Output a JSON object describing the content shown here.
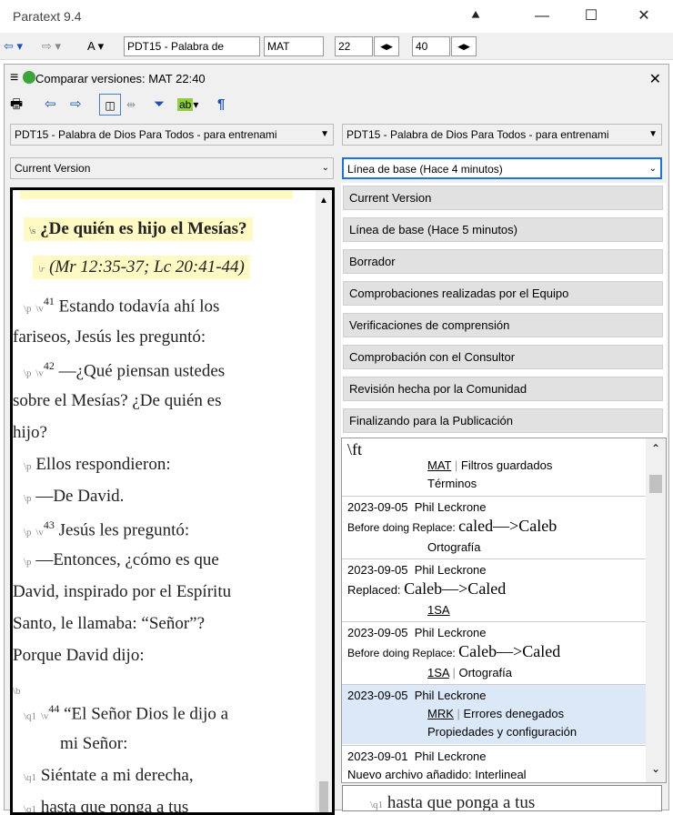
{
  "app": {
    "title": "Paratext 9.4"
  },
  "toolbar": {
    "back": "⇦ ▾",
    "forward": "⇨ ▾",
    "font": "A ▾",
    "project": "PDT15 - Palabra de",
    "book": "MAT",
    "chapter": "22",
    "verse": "40"
  },
  "panel": {
    "title": "Comparar versiones: MAT 22:40",
    "close": "✕",
    "left_text_combo": "PDT15 - Palabra de Dios Para Todos - para entrenami",
    "right_text_combo": "PDT15 - Palabra de Dios Para Todos - para entrenami",
    "left_version": "Current Version",
    "right_version": "Línea de base (Hace 4 minutos)"
  },
  "dropdown": {
    "items": [
      "Current Version",
      "Línea de base (Hace 5 minutos)",
      "Borrador",
      "Comprobaciones realizadas por el Equipo",
      "Verificaciones de comprensión",
      "Comprobación con el Consultor",
      "Revisión hecha por la Comunidad",
      "Finalizando para la Publicación"
    ]
  },
  "history": {
    "top_marker": "\\ft",
    "e0": {
      "book": "MAT",
      "filters": "Filtros guardados",
      "terms": "Términos"
    },
    "e1": {
      "date": "2023-09-05",
      "user": "Phil Leckrone",
      "prefix": "Before doing Replace:",
      "change": "caled—>Caleb",
      "tag": "Ortografía"
    },
    "e2": {
      "date": "2023-09-05",
      "user": "Phil Leckrone",
      "prefix": "Replaced:",
      "change": "Caleb—>Caled",
      "book": "1SA"
    },
    "e3": {
      "date": "2023-09-05",
      "user": "Phil Leckrone",
      "prefix": "Before doing Replace:",
      "change": "Caleb—>Caled",
      "book": "1SA",
      "tag": "Ortografía"
    },
    "e4": {
      "date": "2023-09-05",
      "user": "Phil Leckrone",
      "book": "MRK",
      "tag": "Errores denegados",
      "tag2": "Propiedades y configuración"
    },
    "e5": {
      "date": "2023-09-01",
      "user": "Phil Leckrone",
      "text": "Nuevo archivo añadido: Interlineal"
    }
  },
  "editor": {
    "s_mark": "\\s",
    "heading": "¿De quién es hijo el Mesías?",
    "r_mark": "\\r",
    "ref": "(Mr 12:35-37; Lc 20:41-44)",
    "p": "\\p",
    "v": "\\v",
    "v41": "41",
    "l1": "Estando todavía ahí los",
    "l2": "fariseos, Jesús les preguntó:",
    "v42": "42",
    "l3": "—¿Qué piensan ustedes",
    "l4": "sobre el Mesías? ¿De quién es",
    "l5": "hijo?",
    "l6": "Ellos respondieron:",
    "l7": "—De David.",
    "v43": "43",
    "l8": "Jesús les preguntó:",
    "l9": "—Entonces, ¿cómo es que",
    "l10": "David, inspirado por el Espíritu",
    "l11": "Santo, le llamaba: “Señor”?",
    "l12": "Porque David dijo:",
    "b_mark": "\\b",
    "q1": "\\q1",
    "v44": "44",
    "l13": "“El Señor Dios le dijo a",
    "l14": "mi Señor:",
    "l15": "Siéntate a mi derecha,",
    "l16": "hasta que ponga a tus"
  },
  "right_editor": {
    "q1": "\\q1",
    "line": "hasta que ponga a tus"
  }
}
